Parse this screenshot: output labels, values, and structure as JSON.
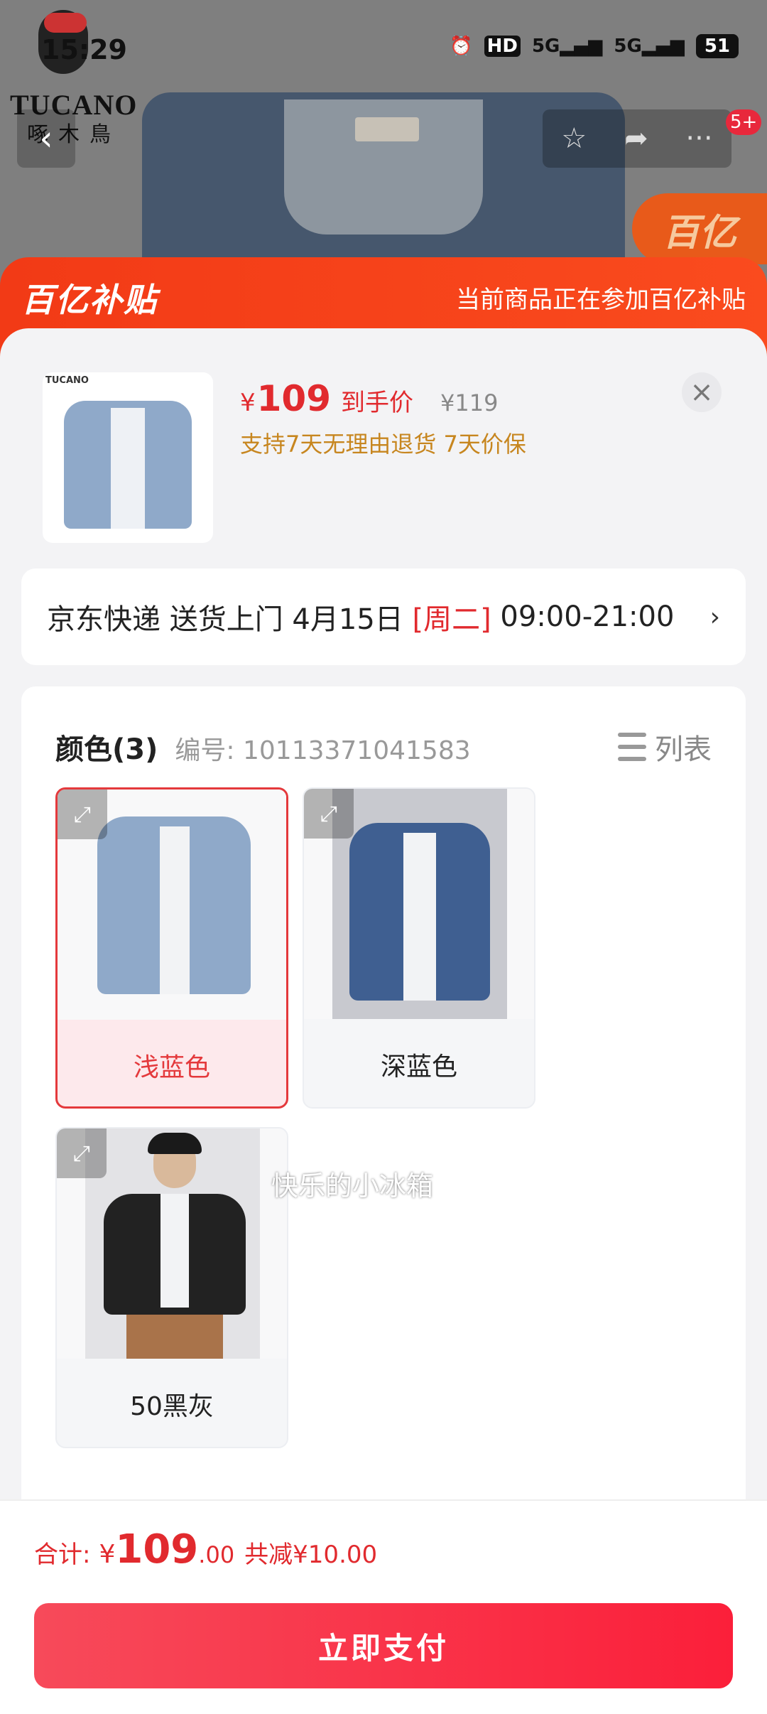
{
  "status_bar": {
    "time": "15:29",
    "icons": [
      "alarm-icon",
      "hd-icon",
      "signal-5g-icon",
      "signal-5g-icon",
      "battery-icon"
    ],
    "battery": "51"
  },
  "background": {
    "brand_logo_text": "TUCANO",
    "brand_logo_cn": "啄木鳥",
    "cart_badge": "5+",
    "corner_badge_text": "百亿"
  },
  "banner": {
    "logo": "百亿补贴",
    "text": "当前商品正在参加百亿补贴"
  },
  "product": {
    "price_currency": "¥",
    "price": "109",
    "price_label": "到手价",
    "original_price": "¥119",
    "tags": "支持7天无理由退货  7天价保"
  },
  "delivery": {
    "prefix": "京东快递 送货上门 4月15日 ",
    "weekday": "[周二]",
    "window": " 09:00-21:00",
    "arrow": "›"
  },
  "options": {
    "title": "颜色(3)",
    "sku": "编号: 10113371041583",
    "list_label": "列表",
    "watermark": "快乐的小冰箱",
    "items": [
      {
        "label": "浅蓝色",
        "selected": true,
        "color": "#8fa9c9"
      },
      {
        "label": "深蓝色",
        "selected": false,
        "color": "#3f5f91"
      },
      {
        "label": "50黑灰",
        "selected": false,
        "color": "#222222"
      }
    ]
  },
  "total": {
    "label": "合计:",
    "currency": "¥",
    "integer": "109",
    "decimal": ".00",
    "savings": "共减¥10.00"
  },
  "pay_button": "立即支付",
  "colors": {
    "accent_red": "#e12a2e",
    "banner_orange": "#f23a16",
    "tag_gold": "#c7861f"
  }
}
